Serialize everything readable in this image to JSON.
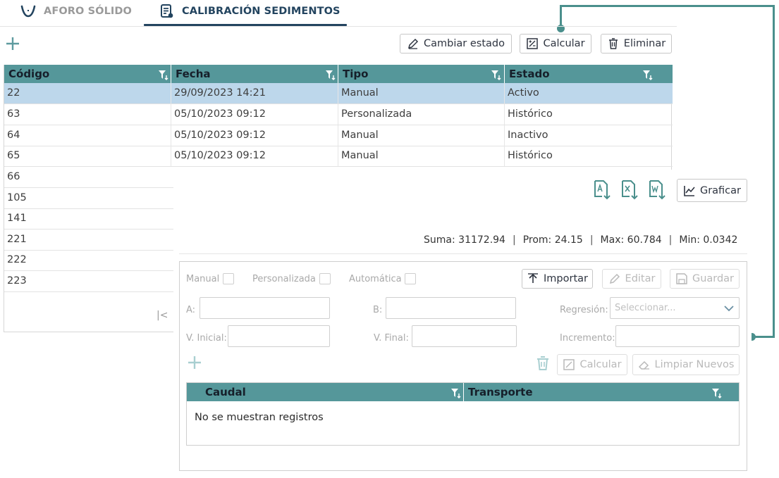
{
  "tabs": [
    {
      "label": "AFORO SÓLIDO",
      "active": false
    },
    {
      "label": "CALIBRACIÓN SEDIMENTOS",
      "active": true
    }
  ],
  "toolbar": {
    "cambiar_estado": "Cambiar estado",
    "calcular": "Calcular",
    "eliminar": "Eliminar"
  },
  "grid": {
    "headers": [
      "Código",
      "Fecha",
      "Tipo",
      "Estado"
    ],
    "rows": [
      {
        "codigo": "22",
        "fecha": "29/09/2023 14:21",
        "tipo": "Manual",
        "estado": "Activo",
        "selected": true
      },
      {
        "codigo": "63",
        "fecha": "05/10/2023 09:12",
        "tipo": "Personalizada",
        "estado": "Histórico"
      },
      {
        "codigo": "64",
        "fecha": "05/10/2023 09:12",
        "tipo": "Manual",
        "estado": "Inactivo"
      },
      {
        "codigo": "65",
        "fecha": "05/10/2023 09:12",
        "tipo": "Manual",
        "estado": "Histórico"
      },
      {
        "codigo": "66"
      },
      {
        "codigo": "105"
      },
      {
        "codigo": "141"
      },
      {
        "codigo": "221"
      },
      {
        "codigo": "222"
      },
      {
        "codigo": "223"
      }
    ],
    "pager_first": "|<"
  },
  "export": {
    "graficar": "Graficar"
  },
  "stats": {
    "suma_label": "Suma:",
    "suma": "31172.94",
    "prom_label": "Prom:",
    "prom": "24.15",
    "max_label": "Max:",
    "max": "60.784",
    "min_label": "Min:",
    "min": "0.0342",
    "separator": "|"
  },
  "form": {
    "manual": "Manual",
    "personalizada": "Personalizada",
    "automatica": "Automática",
    "importar": "Importar",
    "editar": "Editar",
    "guardar": "Guardar",
    "a_label": "A:",
    "b_label": "B:",
    "regresion_label": "Regresión:",
    "regresion_placeholder": "Seleccionar...",
    "v_inicial_label": "V. Inicial:",
    "v_final_label": "V. Final:",
    "incremento_label": "Incremento:",
    "calcular": "Calcular",
    "limpiar_nuevos": "Limpiar Nuevos"
  },
  "subgrid": {
    "headers": [
      "Caudal",
      "Transporte"
    ],
    "empty_message": "No se muestran registros"
  },
  "colors": {
    "header_teal": "#55979a",
    "accent_teal": "#4a8f8c",
    "tab_active": "#23445f",
    "selected_row": "#bdd7eb"
  }
}
